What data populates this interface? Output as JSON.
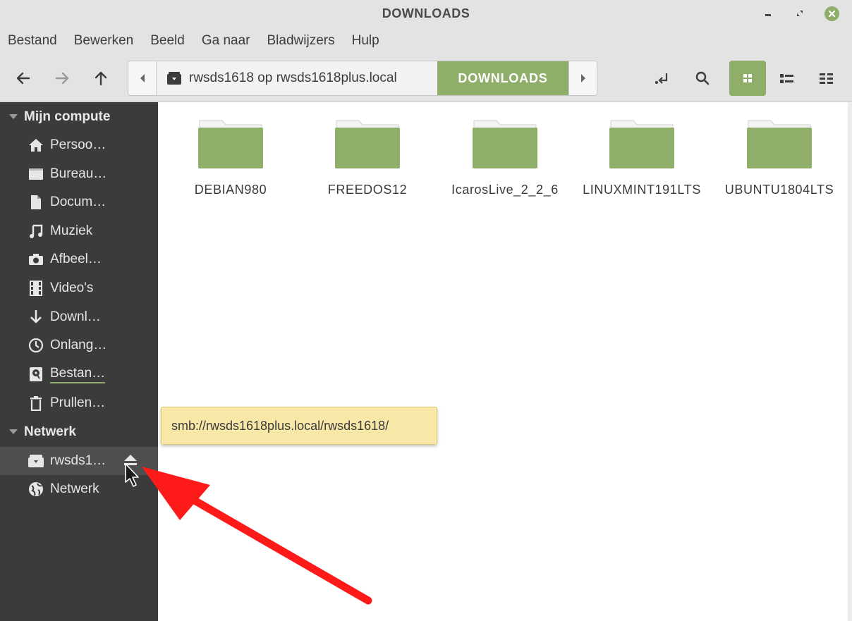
{
  "window": {
    "title": "DOWNLOADS"
  },
  "menu": {
    "items": [
      "Bestand",
      "Bewerken",
      "Beeld",
      "Ga naar",
      "Bladwijzers",
      "Hulp"
    ]
  },
  "toolbar": {
    "back_icon": "arrow-left-icon",
    "forward_icon": "arrow-right-icon",
    "up_icon": "arrow-up-icon",
    "path_host": "rwsds1618 op rwsds1618plus.local",
    "path_current": "DOWNLOADS",
    "active_view": "icon-view",
    "accent": "#8fae6a"
  },
  "sidebar": {
    "section_computer": "Mijn compute",
    "computer_items": [
      {
        "label": "Persoo…",
        "icon": "home-icon"
      },
      {
        "label": "Bureau…",
        "icon": "desktop-icon"
      },
      {
        "label": "Docum…",
        "icon": "document-icon"
      },
      {
        "label": "Muziek",
        "icon": "music-icon"
      },
      {
        "label": "Afbeel…",
        "icon": "camera-icon"
      },
      {
        "label": "Video's",
        "icon": "film-icon"
      },
      {
        "label": "Downl…",
        "icon": "download-icon"
      },
      {
        "label": "Onlang…",
        "icon": "clock-icon"
      },
      {
        "label": "Bestan…",
        "icon": "filesystem-icon"
      },
      {
        "label": "Prullen…",
        "icon": "trash-icon"
      }
    ],
    "section_network": "Netwerk",
    "network_items": [
      {
        "label": "rwsds1…",
        "icon": "network-share-icon"
      },
      {
        "label": "Netwerk",
        "icon": "globe-icon"
      }
    ]
  },
  "folders": [
    {
      "name": "DEBIAN980"
    },
    {
      "name": "FREEDOS12"
    },
    {
      "name": "IcarosLive_2_2_6"
    },
    {
      "name": "LINUXMINT191LTS"
    },
    {
      "name": "UBUNTU1804LTS"
    }
  ],
  "tooltip": {
    "text": "smb://rwsds1618plus.local/rwsds1618/"
  }
}
